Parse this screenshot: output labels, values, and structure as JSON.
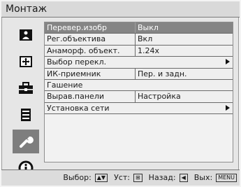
{
  "window": {
    "title": "Монтаж"
  },
  "sidebar": {
    "items": [
      {
        "icon": "picture-icon",
        "active": false
      },
      {
        "icon": "screen-icon",
        "active": false
      },
      {
        "icon": "toolbox-icon",
        "active": false
      },
      {
        "icon": "list-icon",
        "active": false
      },
      {
        "icon": "wrench-icon",
        "active": true
      },
      {
        "icon": "info-icon",
        "active": false
      }
    ]
  },
  "menu": {
    "rows": [
      {
        "label": "Перевер.изобр",
        "value": "Выкл",
        "selected": true
      },
      {
        "label": "Рег.объектива",
        "value": "Вкл"
      },
      {
        "label": "Анаморф. объект.",
        "value": "1.24x"
      },
      {
        "label": "Выбор перекл.",
        "value": "",
        "submenu": true
      },
      {
        "label": "ИК-приемник",
        "value": "Пер. и задн."
      },
      {
        "label": "Гашение",
        "value": ""
      },
      {
        "label": "Вырав.панели",
        "value": "Настройка"
      },
      {
        "label": "Установка сети",
        "value": "",
        "submenu": true
      }
    ]
  },
  "help": {
    "select_label": "Выбор:",
    "select_keys": "▲▼",
    "set_label": "Уст:",
    "set_key": "⊞",
    "back_label": "Назад:",
    "back_key": "◀",
    "exit_label": "Вых:",
    "exit_key": "MENU"
  },
  "colors": {
    "selected_bg": "#858585",
    "active_icon_bg": "#7e7e7e"
  }
}
